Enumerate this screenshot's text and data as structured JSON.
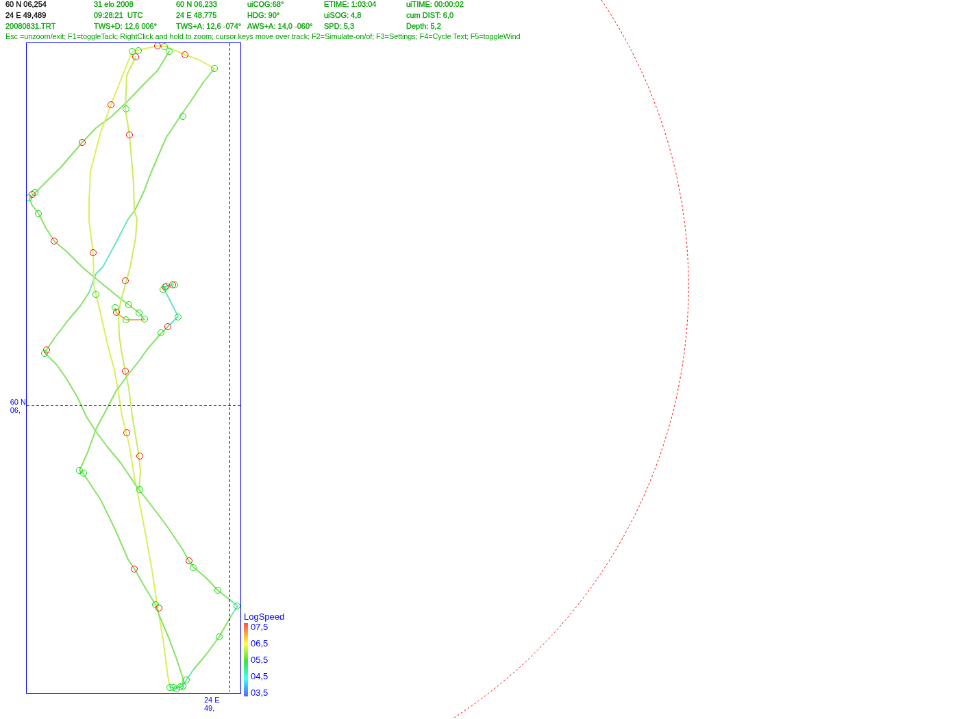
{
  "status_panel": {
    "rows": [
      {
        "cells": [
          {
            "text": "60 N 06,254",
            "color": "#000000"
          },
          {
            "text": "31 elo 2008",
            "color": "#00a000"
          },
          {
            "text": "60 N 06,233",
            "color": "#00a000"
          },
          {
            "text": "uiCOG:68°",
            "color": "#00a000"
          },
          {
            "text": "ETIME: 1:03:04",
            "color": "#00a000"
          },
          {
            "text": "uiTIME: 00:00:02",
            "color": "#00a000"
          }
        ]
      },
      {
        "cells": [
          {
            "text": "24 E 49,489",
            "color": "#000000"
          },
          {
            "text": "09:28:21  UTC",
            "color": "#00a000"
          },
          {
            "text": "24 E 48,775",
            "color": "#00a000"
          },
          {
            "text": "HDG: 90°",
            "color": "#00a000"
          },
          {
            "text": "uiSOG: 4,8",
            "color": "#00a000"
          },
          {
            "text": "cum DIST: 6,0",
            "color": "#00a000"
          }
        ]
      },
      {
        "cells": [
          {
            "text": "20080831.TRT",
            "color": "#00a000"
          },
          {
            "text": "TWS+D: 12,6 006°",
            "color": "#00a000"
          },
          {
            "text": "TWS+A: 12,6 -074°",
            "color": "#00a000"
          },
          {
            "text": "AWS+A: 14,0 -060°",
            "color": "#00a000"
          },
          {
            "text": "SPD: 5,3",
            "color": "#00a000"
          },
          {
            "text": "Depth: 5,2",
            "color": "#00a000"
          }
        ]
      }
    ]
  },
  "help_text": "Esc =unzoom/exit; F1=toggleTack; RightClick and hold to zoom; cursor keys move over track; F2=Simulate-on/of; F3=Settings; F4=Cycle Text; F5=toggleWind",
  "track_plot": {
    "latitude_label": [
      "60 N",
      "06,"
    ],
    "longitude_label": [
      "24 E",
      "49,"
    ]
  },
  "legend": {
    "title": "LogSpeed",
    "ticks": [
      "07,5",
      "06,5",
      "05,5",
      "04,5",
      "03,5"
    ]
  }
}
